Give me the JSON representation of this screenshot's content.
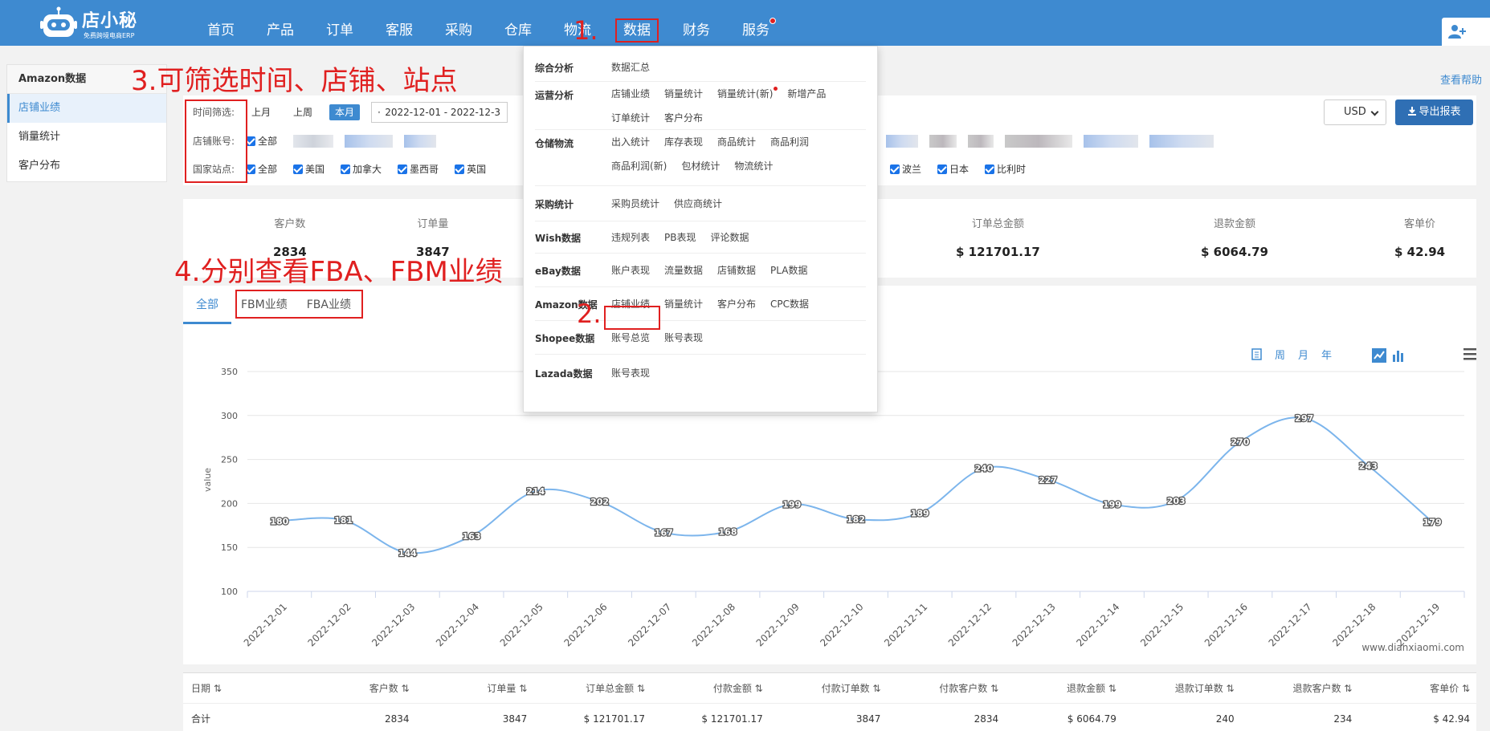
{
  "header": {
    "logo_name": "店小秘",
    "logo_slogan": "免费跨境电商ERP",
    "nav": [
      {
        "label": "首页"
      },
      {
        "label": "产品"
      },
      {
        "label": "订单"
      },
      {
        "label": "客服"
      },
      {
        "label": "采购"
      },
      {
        "label": "仓库"
      },
      {
        "label": "物流"
      },
      {
        "label": "数据"
      },
      {
        "label": "财务"
      },
      {
        "label": "服务"
      }
    ]
  },
  "sidebar": {
    "title": "Amazon数据",
    "items": [
      {
        "label": "店铺业绩"
      },
      {
        "label": "销量统计"
      },
      {
        "label": "客户分布"
      }
    ]
  },
  "help_link": "查看帮助",
  "filters": {
    "time_label": "时间筛选:",
    "time_options": [
      "上月",
      "上周",
      "本月"
    ],
    "date_range": "2022-12-01 - 2022-12-3",
    "account_label": "店铺账号:",
    "account_all": "全部",
    "site_label": "国家站点:",
    "sites_left": [
      "全部",
      "美国",
      "加拿大",
      "墨西哥",
      "英国"
    ],
    "sites_right": [
      "波兰",
      "日本",
      "比利时"
    ],
    "currency": "USD",
    "export": "导出报表"
  },
  "stats": [
    {
      "label": "客户数",
      "value": "2834"
    },
    {
      "label": "订单量",
      "value": "3847"
    },
    {
      "label": "订单总金额",
      "value": "$ 121701.17"
    },
    {
      "label": "退款金额",
      "value": "$ 6064.79"
    },
    {
      "label": "客单价",
      "value": "$ 42.94"
    }
  ],
  "chart_tabs": [
    "全部",
    "FBM业绩",
    "FBA业绩"
  ],
  "chart_tools": [
    "周",
    "月",
    "年"
  ],
  "chart_watermark": "www.dianxiaomi.com",
  "chart_data": {
    "type": "line",
    "ylabel": "value",
    "ylim": [
      100,
      350
    ],
    "yticks": [
      100,
      150,
      200,
      250,
      300,
      350
    ],
    "categories": [
      "2022-12-01",
      "2022-12-02",
      "2022-12-03",
      "2022-12-04",
      "2022-12-05",
      "2022-12-06",
      "2022-12-07",
      "2022-12-08",
      "2022-12-09",
      "2022-12-10",
      "2022-12-11",
      "2022-12-12",
      "2022-12-13",
      "2022-12-14",
      "2022-12-15",
      "2022-12-16",
      "2022-12-17",
      "2022-12-18",
      "2022-12-19"
    ],
    "values": [
      180,
      181,
      144,
      163,
      214,
      202,
      167,
      168,
      199,
      182,
      189,
      240,
      227,
      199,
      203,
      270,
      297,
      243,
      179
    ],
    "grid": true,
    "line_color": "#7cb5ec"
  },
  "table": {
    "headers": [
      "日期",
      "客户数",
      "订单量",
      "订单总金额",
      "付款金额",
      "付款订单数",
      "付款客户数",
      "退款金额",
      "退款订单数",
      "退款客户数",
      "客单价"
    ],
    "total_row": [
      "合计",
      "2834",
      "3847",
      "$ 121701.17",
      "$ 121701.17",
      "3847",
      "2834",
      "$ 6064.79",
      "240",
      "234",
      "$ 42.94"
    ]
  },
  "mega_menu": [
    {
      "cat": "综合分析",
      "links": [
        "数据汇总"
      ]
    },
    {
      "cat": "运营分析",
      "links": [
        "店铺业绩",
        "销量统计",
        "销量统计(新)",
        "新增产品",
        "订单统计",
        "客户分布"
      ]
    },
    {
      "cat": "仓储物流",
      "links": [
        "出入统计",
        "库存表现",
        "商品统计",
        "商品利润",
        "商品利润(新)",
        "包材统计",
        "物流统计"
      ]
    },
    {
      "cat": "采购统计",
      "links": [
        "采购员统计",
        "供应商统计"
      ]
    },
    {
      "cat": "Wish数据",
      "links": [
        "违规列表",
        "PB表现",
        "评论数据"
      ]
    },
    {
      "cat": "eBay数据",
      "links": [
        "账户表现",
        "流量数据",
        "店铺数据",
        "PLA数据"
      ]
    },
    {
      "cat": "Amazon数据",
      "links": [
        "店铺业绩",
        "销量统计",
        "客户分布",
        "CPC数据"
      ]
    },
    {
      "cat": "Shopee数据",
      "links": [
        "账号总览",
        "账号表现"
      ]
    },
    {
      "cat": "Lazada数据",
      "links": [
        "账号表现"
      ]
    }
  ],
  "annotations": {
    "a1": "1.",
    "a2": "2.",
    "a3": "3.可筛选时间、店铺、站点",
    "a4": "4.分别查看FBA、FBM业绩"
  },
  "colors": {
    "primary": "#3e8ad0",
    "annotation": "#e02020",
    "checkbox": "#1a73e8"
  }
}
